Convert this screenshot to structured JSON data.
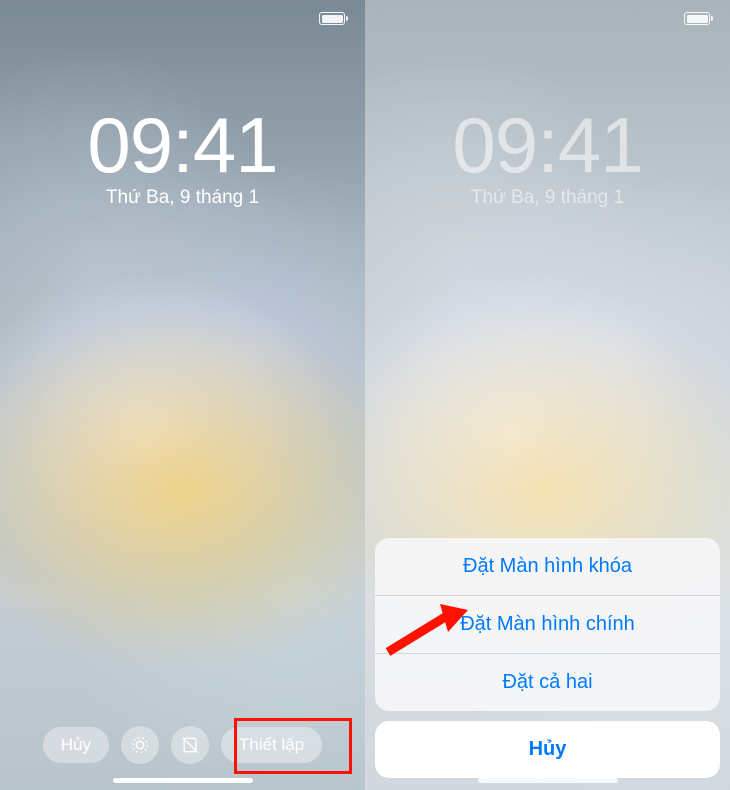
{
  "lockscreen": {
    "time": "09:41",
    "date": "Thứ Ba, 9 tháng 1"
  },
  "toolbar": {
    "cancel": "Hủy",
    "setup": "Thiết lập"
  },
  "sheet": {
    "lock": "Đặt Màn hình khóa",
    "home": "Đặt Màn hình chính",
    "both": "Đặt cả hai",
    "cancel": "Hủy"
  },
  "colors": {
    "accent": "#007aff",
    "highlight": "#ff1100"
  }
}
